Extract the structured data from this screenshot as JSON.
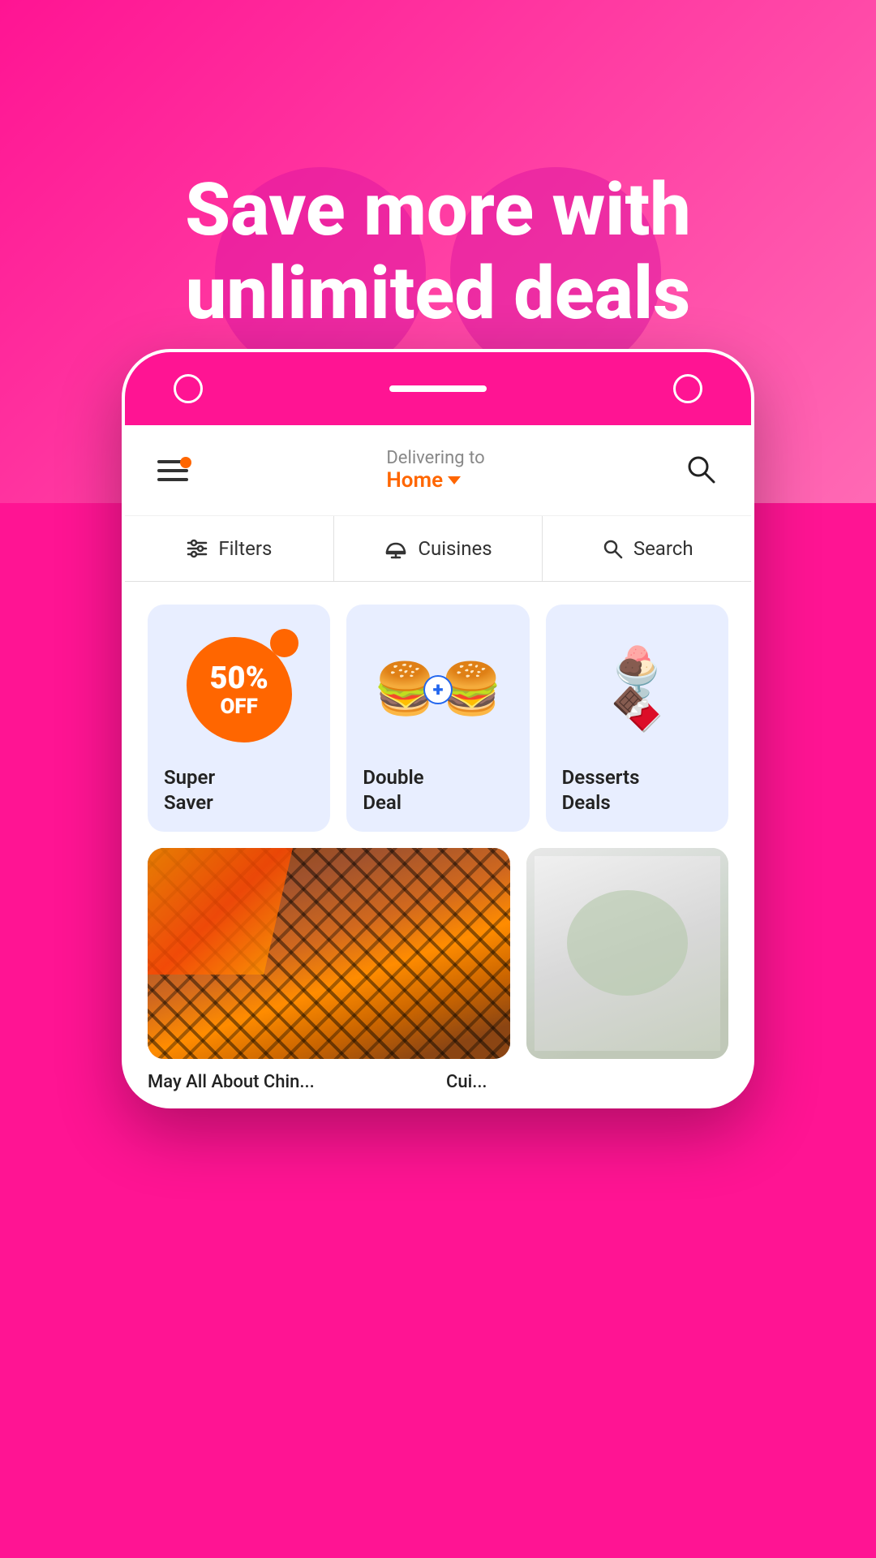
{
  "hero": {
    "title": "Save more with unlimited deals",
    "background_color": "#FF1493"
  },
  "phone": {
    "header": {
      "delivering_label": "Delivering to",
      "location": "Home",
      "chevron": "▾"
    },
    "filter_bar": {
      "filters_label": "Filters",
      "cuisines_label": "Cuisines",
      "search_label": "Search"
    },
    "deals": [
      {
        "badge": "50% OFF",
        "badge_percent": "50%",
        "badge_off": "OFF",
        "label": "Super\nSaver"
      },
      {
        "label": "Double\nDeal"
      },
      {
        "label": "Desserts\nDeals"
      }
    ],
    "food_sections": [
      {
        "label": "May All About Chin..."
      },
      {
        "label": "Cui..."
      }
    ]
  }
}
